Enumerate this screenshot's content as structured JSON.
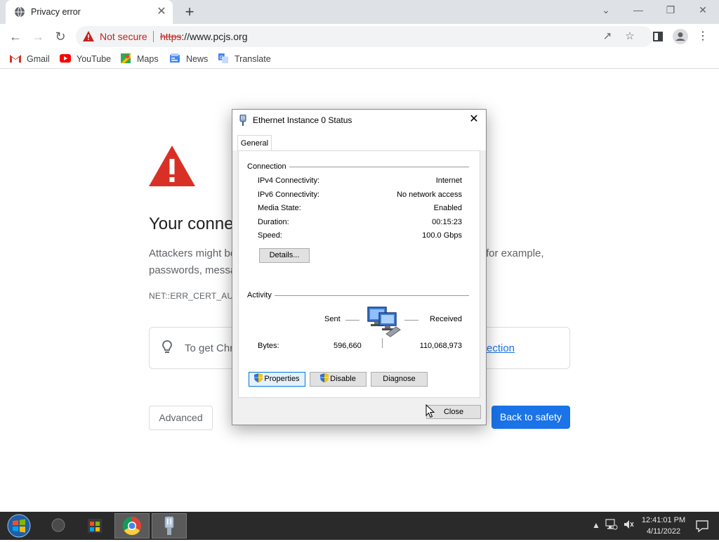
{
  "browser": {
    "tab_title": "Privacy error",
    "tab_close": "✕",
    "new_tab": "+",
    "window_controls": {
      "tab_search": "⌄",
      "minimize": "—",
      "restore": "❐",
      "close": "✕"
    },
    "not_secure": "Not secure",
    "url_scheme": "https",
    "url_rest": "://www.pcjs.org",
    "bookmarks": [
      "Gmail",
      "YouTube",
      "Maps",
      "News",
      "Translate"
    ]
  },
  "page": {
    "headline": "Your conne",
    "description": "Attackers might be",
    "description_line2": "passwords, messa",
    "description_right": "for example,",
    "error_code": "NET::ERR_CERT_AUTHO",
    "tip_text": "To get Chr",
    "tip_link": "ection",
    "advanced_button": "Advanced",
    "back_button": "Back to safety"
  },
  "dialog": {
    "title": "Ethernet Instance 0 Status",
    "close_glyph": "✕",
    "tab": "General",
    "connection_group": "Connection",
    "rows": [
      {
        "label": "IPv4 Connectivity:",
        "value": "Internet"
      },
      {
        "label": "IPv6 Connectivity:",
        "value": "No network access"
      },
      {
        "label": "Media State:",
        "value": "Enabled"
      },
      {
        "label": "Duration:",
        "value": "00:15:23"
      },
      {
        "label": "Speed:",
        "value": "100.0 Gbps"
      }
    ],
    "details_button": "Details...",
    "activity_group": "Activity",
    "sent_label": "Sent",
    "received_label": "Received",
    "bytes_label": "Bytes:",
    "bytes_sent": "596,660",
    "bytes_received": "110,068,973",
    "properties_button": "Properties",
    "disable_button": "Disable",
    "diagnose_button": "Diagnose",
    "close_button": "Close"
  },
  "taskbar": {
    "time": "12:41:01 PM",
    "date": "4/11/2022"
  },
  "colors": {
    "accent": "#1a73e8",
    "danger": "#c5221f",
    "warning_icon": "#d93025"
  }
}
